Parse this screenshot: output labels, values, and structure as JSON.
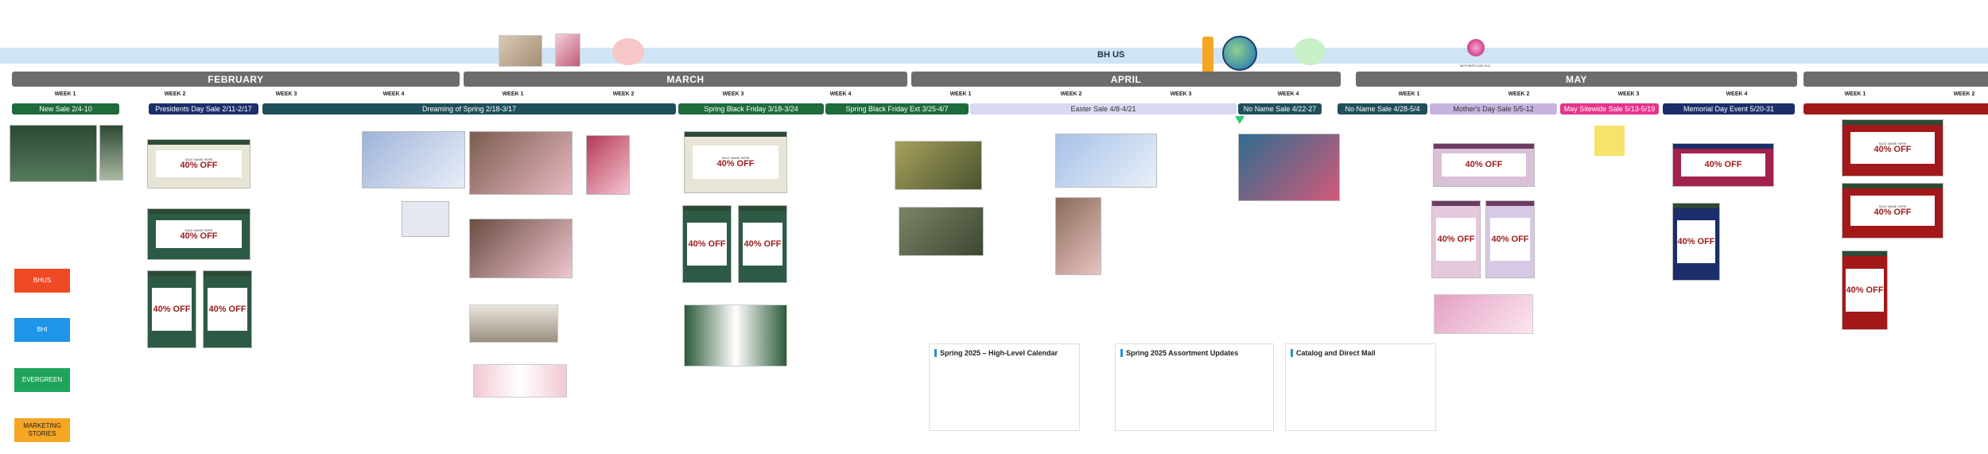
{
  "header": {
    "title": "BH US",
    "mothers_day_label": "MOTHER'S DAY 5/11"
  },
  "months": [
    {
      "key": "feb",
      "label": "FEBRUARY"
    },
    {
      "key": "mar",
      "label": "MARCH"
    },
    {
      "key": "apr",
      "label": "APRIL"
    },
    {
      "key": "may",
      "label": "MAY"
    }
  ],
  "weeks": {
    "w1": "WEEK 1",
    "w2": "WEEK 2",
    "w3": "WEEK 3",
    "w4": "WEEK 4"
  },
  "sales": [
    {
      "label": "New Sale 2/4-10",
      "color": "#1e6b3b"
    },
    {
      "label": "Presidents Day Sale 2/11-2/17",
      "color": "#1b2e6b"
    },
    {
      "label": "Dreaming of Spring 2/18-3/17",
      "color": "#1e4f5a"
    },
    {
      "label": "Spring Black Friday 3/18-3/24",
      "color": "#1e6b3b"
    },
    {
      "label": "Spring Black Friday Ext 3/25-4/7",
      "color": "#1e6b3b"
    },
    {
      "label": "Easter Sale 4/8-4/21",
      "color": "#d8d9f2"
    },
    {
      "label": "No Name Sale 4/22-27",
      "color": "#1e4f5a"
    },
    {
      "label": "No Name Sale 4/28-5/4",
      "color": "#1e4f5a"
    },
    {
      "label": "Mother's Day Sale 5/5-12",
      "color": "#c7b3e0"
    },
    {
      "label": "May Sitewide Sale 5/13-5/19",
      "color": "#e8338a"
    },
    {
      "label": "Memorial Day Event 5/20-31",
      "color": "#1b2e6b"
    },
    {
      "label": "",
      "color": "#a31818"
    }
  ],
  "legend": [
    {
      "label": "BHUS",
      "color": "#f04a24"
    },
    {
      "label": "BHI",
      "color": "#1f95e8"
    },
    {
      "label": "EVERGREEN",
      "color": "#1fa55a"
    },
    {
      "label": "MARKETING STORIES",
      "color": "#f5a623"
    }
  ],
  "promo": {
    "off": "40% OFF",
    "sale_name": "SALE NAME HERE"
  },
  "notes": {
    "calendar_title": "Spring 2025 – High-Level Calendar",
    "assortment_title": "Spring 2025 Assortment Updates",
    "catalog_title": "Catalog and Direct Mail"
  }
}
